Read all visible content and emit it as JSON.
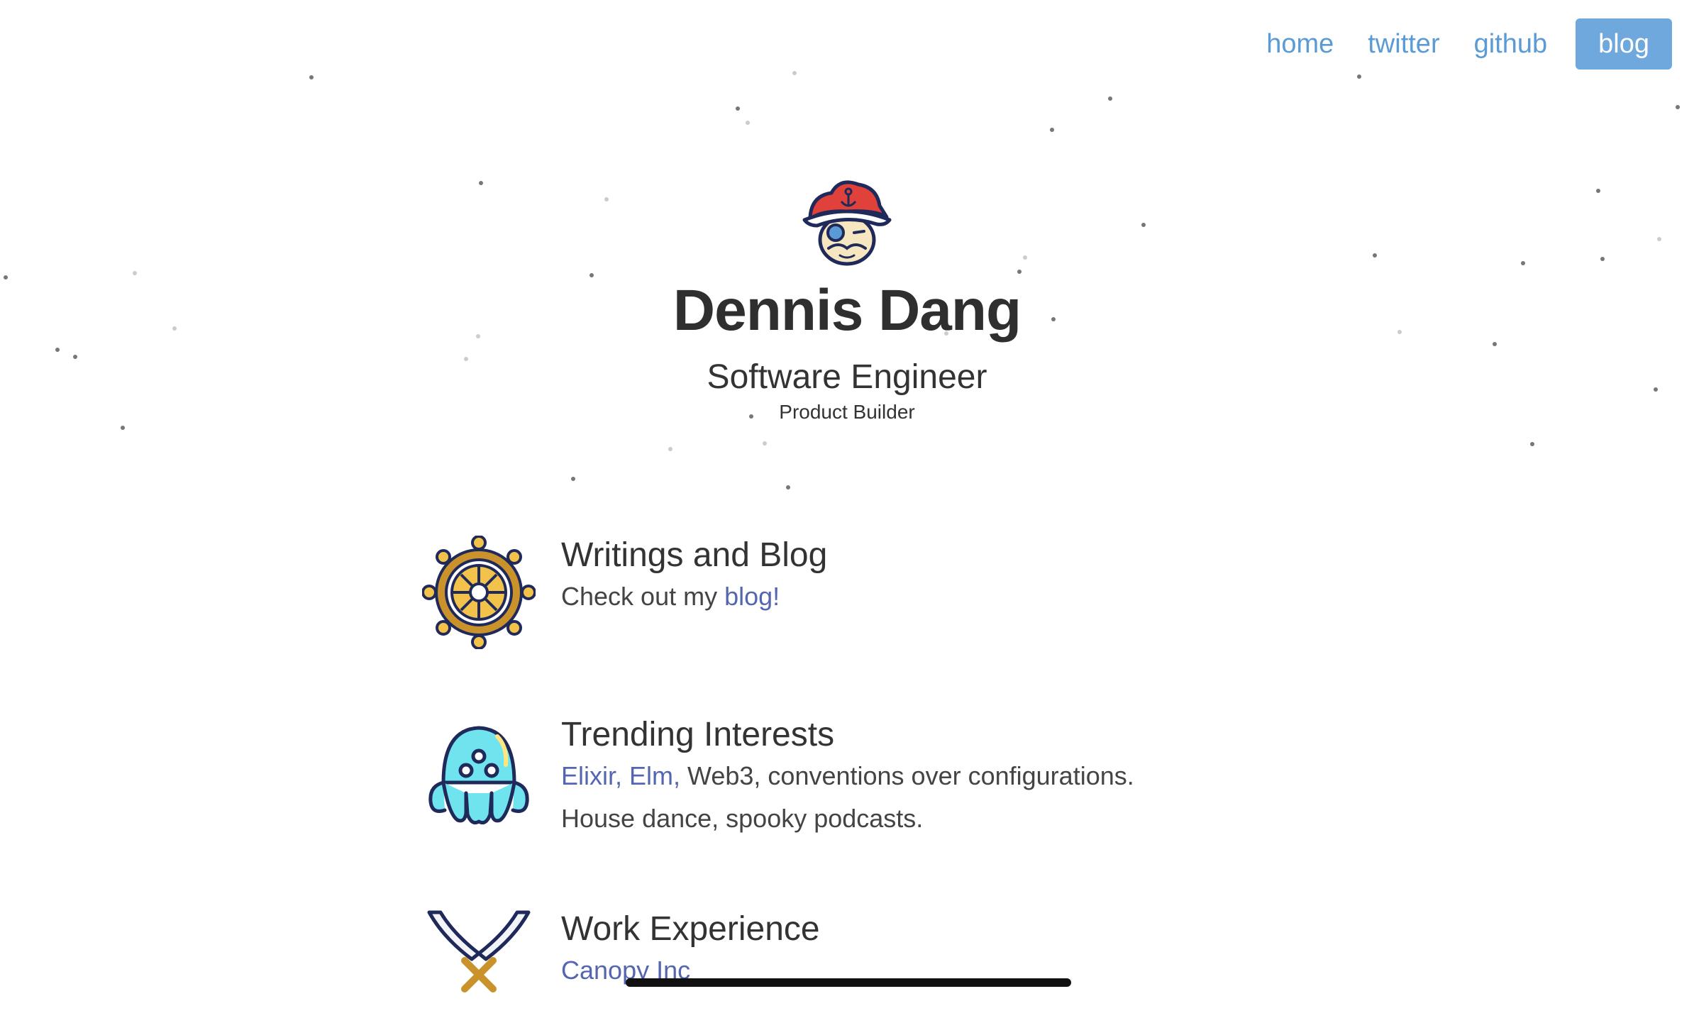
{
  "nav": {
    "items": [
      {
        "label": "home"
      },
      {
        "label": "twitter"
      },
      {
        "label": "github"
      },
      {
        "label": "blog",
        "active": true
      }
    ]
  },
  "hero": {
    "name": "Dennis Dang",
    "role": "Software Engineer",
    "subrole": "Product Builder",
    "avatar_icon": "pirate-avatar-icon"
  },
  "sections": {
    "writings": {
      "title": "Writings and Blog",
      "text_prefix": "Check out my ",
      "link_label": "blog!",
      "icon": "ship-wheel-icon"
    },
    "interests": {
      "title": "Trending Interests",
      "links": [
        "Elixir,",
        "Elm,"
      ],
      "line1_rest": " Web3, conventions over configurations.",
      "line2": "House dance, spooky podcasts.",
      "icon": "octopus-icon"
    },
    "work": {
      "title": "Work Experience",
      "first_company": "Canopy Inc",
      "icon": "crossed-swords-icon"
    }
  },
  "colors": {
    "nav_link": "#5b9bd5",
    "nav_active_bg": "#6fa8dc",
    "text_link": "#5566b0",
    "heading": "#2f2f2f"
  }
}
